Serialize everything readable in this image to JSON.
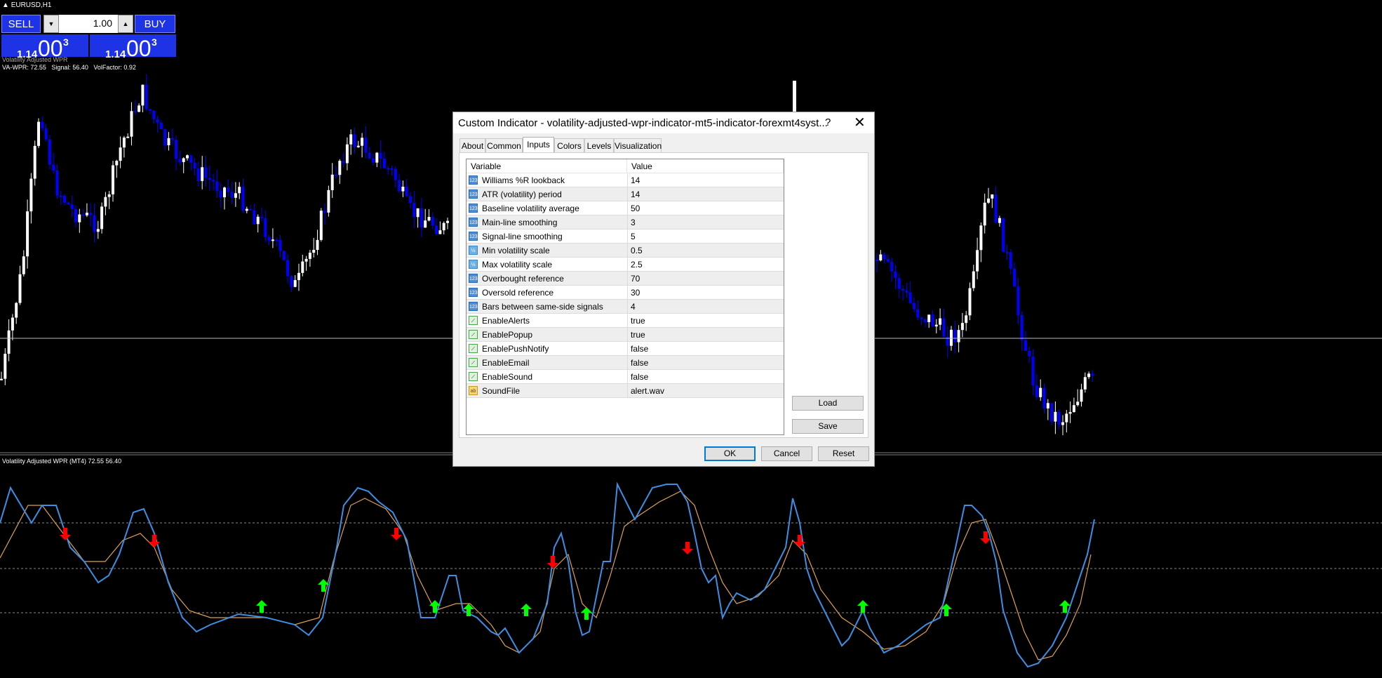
{
  "symbol": "EURUSD,H1",
  "trade_panel": {
    "sell_label": "SELL",
    "buy_label": "BUY",
    "lot": "1.00",
    "sell_price": {
      "small": "1.14",
      "big": "00",
      "sup": "3"
    },
    "buy_price": {
      "small": "1.14",
      "big": "00",
      "sup": "3"
    }
  },
  "main_indicator": {
    "name": "Volatility Adjusted WPR",
    "values": "VA-WPR: 72.55   Signal: 56.40   VolFactor: 0.92"
  },
  "sub_window_label": "Volatility Adjusted WPR (MT4) 72.55 56.40",
  "dialog": {
    "title": "Custom Indicator - volatility-adjusted-wpr-indicator-mt5-indicator-forexmt4syst...",
    "help_label": "?",
    "close_label": "✕",
    "tabs": [
      "About",
      "Common",
      "Inputs",
      "Colors",
      "Levels",
      "Visualization"
    ],
    "active_tab": "Inputs",
    "columns": [
      "Variable",
      "Value"
    ],
    "params": [
      {
        "icon": "123",
        "type": "num",
        "name": "Williams %R lookback",
        "value": "14"
      },
      {
        "icon": "123",
        "type": "num",
        "name": "ATR (volatility) period",
        "value": "14"
      },
      {
        "icon": "123",
        "type": "num",
        "name": "Baseline volatility average",
        "value": "50"
      },
      {
        "icon": "123",
        "type": "num",
        "name": "Main-line smoothing",
        "value": "3"
      },
      {
        "icon": "123",
        "type": "num",
        "name": "Signal-line smoothing",
        "value": "5"
      },
      {
        "icon": "½",
        "type": "dbl",
        "name": "Min volatility scale",
        "value": "0.5"
      },
      {
        "icon": "½",
        "type": "dbl",
        "name": "Max volatility scale",
        "value": "2.5"
      },
      {
        "icon": "123",
        "type": "num",
        "name": "Overbought reference",
        "value": "70"
      },
      {
        "icon": "123",
        "type": "num",
        "name": "Oversold reference",
        "value": "30"
      },
      {
        "icon": "123",
        "type": "num",
        "name": "Bars between same-side signals",
        "value": "4"
      },
      {
        "icon": "⟋",
        "type": "bool",
        "name": "EnableAlerts",
        "value": "true"
      },
      {
        "icon": "⟋",
        "type": "bool",
        "name": "EnablePopup",
        "value": "true"
      },
      {
        "icon": "⟋",
        "type": "bool",
        "name": "EnablePushNotify",
        "value": "false"
      },
      {
        "icon": "⟋",
        "type": "bool",
        "name": "EnableEmail",
        "value": "false"
      },
      {
        "icon": "⟋",
        "type": "bool",
        "name": "EnableSound",
        "value": "false"
      },
      {
        "icon": "ab",
        "type": "str",
        "name": "SoundFile",
        "value": "alert.wav"
      }
    ],
    "load_label": "Load",
    "save_label": "Save",
    "ok_label": "OK",
    "cancel_label": "Cancel",
    "reset_label": "Reset"
  },
  "colors": {
    "bull_candle": "#ffffff",
    "bear_candle": "#0000ff",
    "wpr_line": "#3d8fe6",
    "signal_line": "#e0a050",
    "buy_arrow": "#00ff00",
    "sell_arrow": "#ff0000",
    "panel_blue": "#1e32e6"
  }
}
